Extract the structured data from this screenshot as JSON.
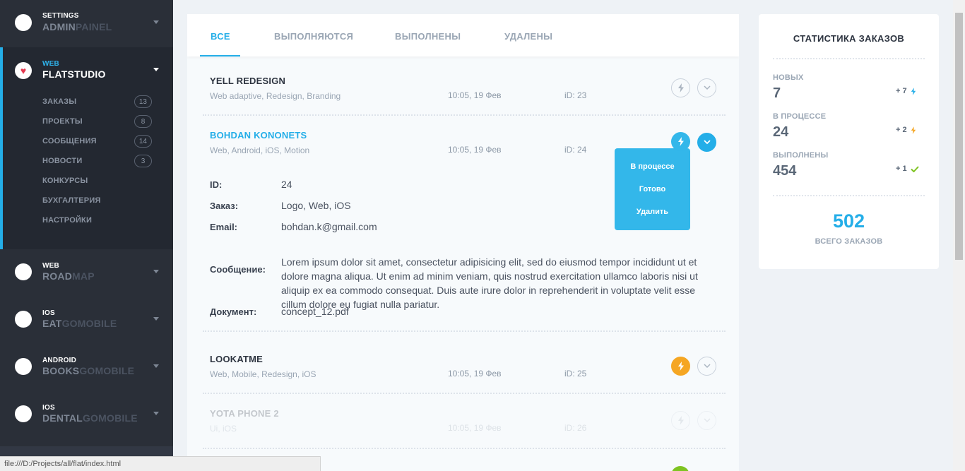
{
  "sidebar": {
    "projects": [
      {
        "small": "SETTINGS",
        "big1": "ADMIN",
        "big2": "PAINEL"
      },
      {
        "small": "WEB",
        "big1": "FLATSTUDIO",
        "big2": ""
      },
      {
        "small": "WEB",
        "big1": "ROAD",
        "big2": "MAP"
      },
      {
        "small": "IOS",
        "big1": "EAT",
        "big2": "GOMOBILE"
      },
      {
        "small": "ANDROID",
        "big1": "BOOKS",
        "big2": "GOMOBILE"
      },
      {
        "small": "IOS",
        "big1": "DENTAL",
        "big2": "GOMOBILE"
      }
    ],
    "menu": [
      {
        "label": "ЗАКАЗЫ",
        "count": "13"
      },
      {
        "label": "ПРОЕКТЫ",
        "count": "8"
      },
      {
        "label": "СООБЩЕНИЯ",
        "count": "14"
      },
      {
        "label": "НОВОСТИ",
        "count": "3"
      },
      {
        "label": "КОНКУРСЫ",
        "count": ""
      },
      {
        "label": "БУХГАЛТЕРИЯ",
        "count": ""
      },
      {
        "label": "НАСТРОЙКИ",
        "count": ""
      }
    ]
  },
  "tabs": [
    "ВСЕ",
    "ВЫПОЛНЯЮТСЯ",
    "ВЫПОЛНЕНЫ",
    "УДАЛЕНЫ"
  ],
  "orders": [
    {
      "title": "YELL REDESIGN",
      "tags": "Web adaptive, Redesign, Branding",
      "time": "10:05, 19 Фев",
      "id": "iD: 23"
    },
    {
      "title": "BOHDAN KONONETS",
      "tags": "Web, Android, iOS, Motion",
      "time": "10:05, 19 Фев",
      "id": "iD: 24"
    },
    {
      "title": "LOOKATME",
      "tags": "Web, Mobile, Redesign, iOS",
      "time": "10:05, 19 Фев",
      "id": "iD: 25"
    },
    {
      "title": "YOTA PHONE 2",
      "tags": "Ui, iOS",
      "time": "10:05, 19 Фев",
      "id": "iD: 26"
    }
  ],
  "details": {
    "id_label": "ID:",
    "id_value": "24",
    "order_label": "Заказ:",
    "order_value": "Logo, Web, iOS",
    "email_label": "Email:",
    "email_value": "bohdan.k@gmail.com",
    "message_label": "Сообщение:",
    "message_value": "Lorem ipsum dolor sit amet, consectetur adipisicing elit, sed do eiusmod tempor incididunt ut et dolore magna aliqua. Ut enim ad minim veniam, quis nostrud exercitation ullamco laboris nisi ut aliquip ex ea commodo consequat. Duis aute irure dolor in reprehenderit in voluptate velit esse cillum dolore eu fugiat nulla pariatur.",
    "document_label": "Документ:",
    "document_value": "concept_12.pdf"
  },
  "dropdown": [
    "В процессе",
    "Готово",
    "Удалить"
  ],
  "stats": {
    "title": "СТАТИСТИКА ЗАКАЗОВ",
    "rows": [
      {
        "label": "НОВЫХ",
        "value": "7",
        "delta": "+ 7",
        "icon": "bolt-icon",
        "color": "#24aee8"
      },
      {
        "label": "В ПРОЦЕССЕ",
        "value": "24",
        "delta": "+ 2",
        "icon": "bolt-icon",
        "color": "#f5a623"
      },
      {
        "label": "ВЫПОЛНЕНЫ",
        "value": "454",
        "delta": "+ 1",
        "icon": "check-icon",
        "color": "#7ec321"
      }
    ],
    "total": "502",
    "total_label": "ВСЕГО ЗАКАЗОВ"
  },
  "statusbar": "file:///D:/Projects/all/flat/index.html",
  "colors": {
    "accent": "#24aee8",
    "orange": "#f5a623",
    "green": "#7ec321",
    "sidebar": "#2a2f38"
  }
}
